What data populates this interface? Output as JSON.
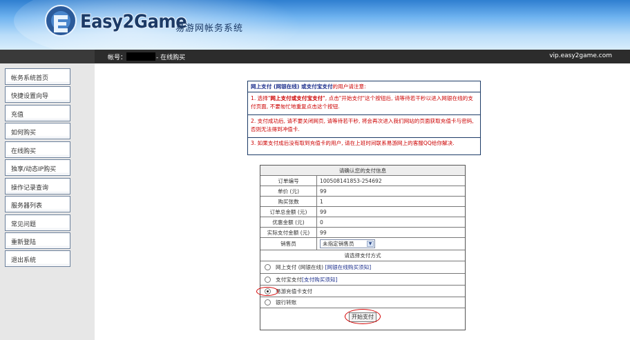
{
  "header": {
    "brand": "Easy2Game",
    "subtitle": "易游网帐务系统"
  },
  "topbar": {
    "account_label": "帐号：",
    "breadcrumb_current": "- 在线购买",
    "site_host": "vip.easy2game.com"
  },
  "sidebar": {
    "items": [
      {
        "label": "帐务系统首页"
      },
      {
        "label": "快捷设置向导"
      },
      {
        "label": "充值"
      },
      {
        "label": "如何购买"
      },
      {
        "label": "在线购买"
      },
      {
        "label": "独享/动态IP购买"
      },
      {
        "label": "操作记录查询"
      },
      {
        "label": "服务器列表"
      },
      {
        "label": "常见问题"
      },
      {
        "label": "重新登陆"
      },
      {
        "label": "退出系统"
      }
    ]
  },
  "notice": {
    "head_bold": "网上支付 (网银在线) 或支付宝支付",
    "head_rest": "的用户请注意:",
    "item1_pre": "1. 选择\"",
    "item1_bold": "网上支付或支付宝支付",
    "item1_post": "\", 点击\"开始支付\"这个按钮后, 请等待若干秒以进入网银在线的支付页面, 不要匆忙地重复点击这个按钮.",
    "item2": "2. 支付成功后, 请不要关闭网页, 请等待若干秒, 将会再次进入我们网站的页面获取充值卡与密码, 否则无法得到冲值卡.",
    "item3": "3. 如果支付成后没有取到充值卡的用户, 请在上班时间联系易游网上的客服QQ给你解决."
  },
  "payment": {
    "title": "请确认您的支付信息",
    "rows": [
      {
        "label": "订单编号",
        "value": "100508141853-254692"
      },
      {
        "label": "单价 (元)",
        "value": "99"
      },
      {
        "label": "购买张数",
        "value": "1"
      },
      {
        "label": "订单总金额 (元)",
        "value": "99"
      },
      {
        "label": "优惠金额 (元)",
        "value": "0"
      },
      {
        "label": "实际支付金额 (元)",
        "value": "99"
      }
    ],
    "seller_label": "销售员",
    "seller_selected": "未指定销售员",
    "method_title": "请选择支付方式",
    "methods": [
      {
        "label": "网上支付 (网银在线)",
        "link": "[网银在线购买须知]"
      },
      {
        "label": "支付宝支付",
        "link": "[支付购买须知]"
      },
      {
        "label": "易游充值卡支付"
      },
      {
        "label": "银行转账"
      }
    ],
    "selected_method": "易游充值卡支付",
    "pay_button": "开始支付"
  },
  "colors": {
    "header_blue": "#2f7fd0",
    "topbar": "#2c2c2c",
    "notice_red": "#cc0000",
    "link_blue": "#1c2f8c",
    "highlight_red": "#d40000"
  }
}
